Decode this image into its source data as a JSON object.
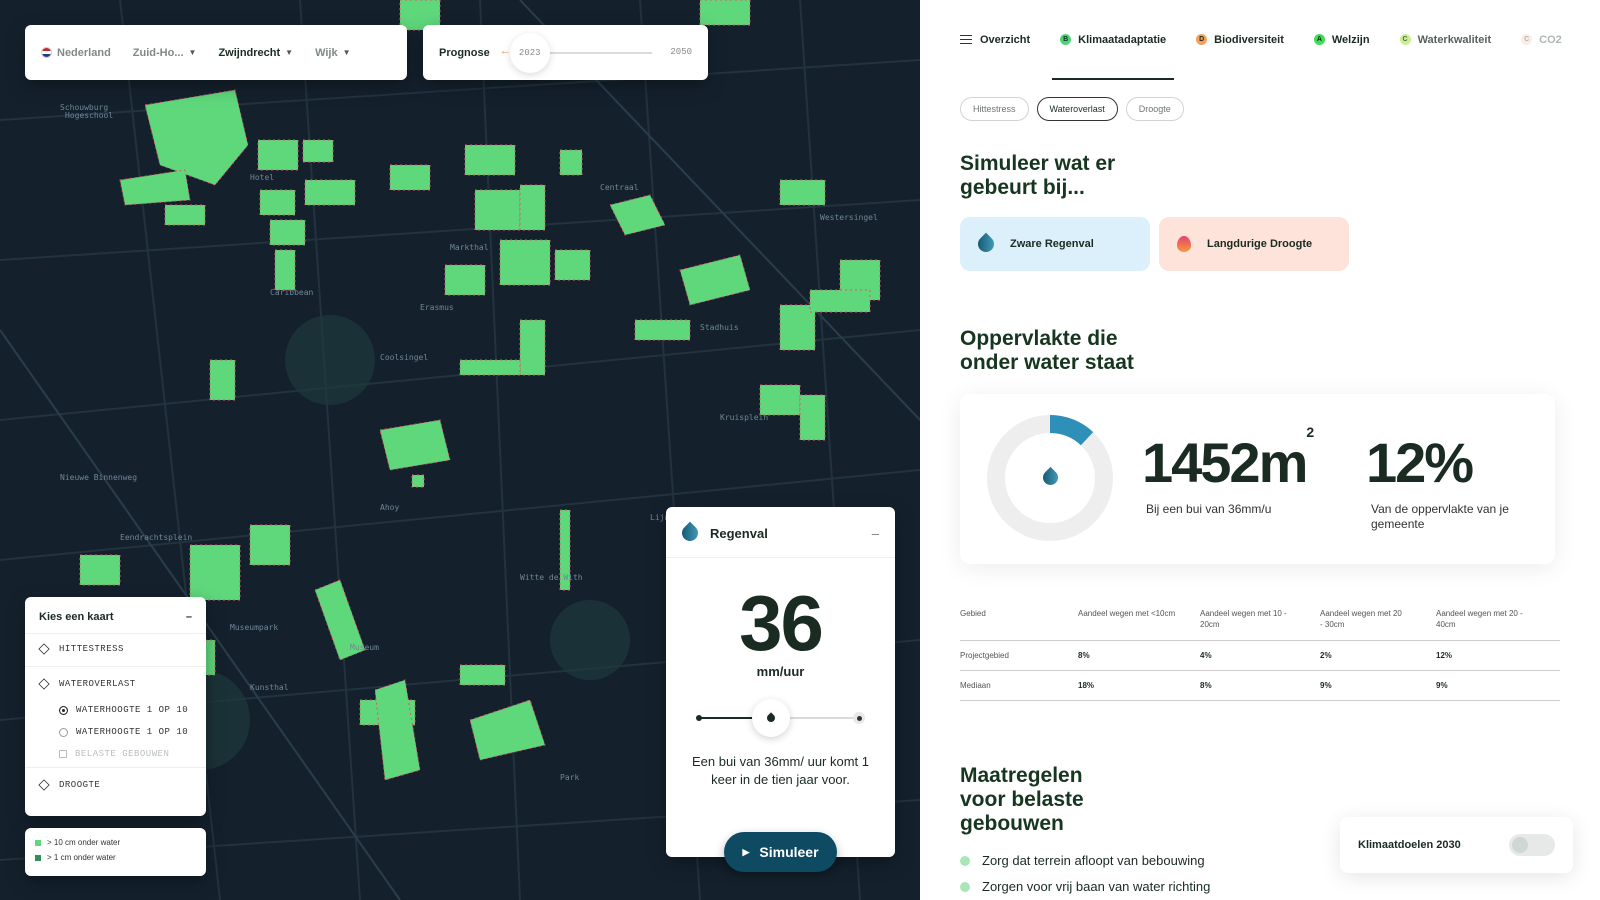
{
  "location": {
    "country": "Nederland",
    "province": "Zuid-Ho...",
    "municipality": "Zwijndrecht",
    "district": "Wijk"
  },
  "prognose": {
    "label": "Prognose",
    "start": "2023",
    "end": "2050"
  },
  "map_labels": [
    "Schouwburg",
    "Hogeschool",
    "Hotel",
    "Caribbean",
    "Ahoy",
    "Museumpark",
    "Kunsthal",
    "Erasmus",
    "Stadhuis",
    "Centraal",
    "Markthal",
    "Witte de With",
    "Lijnbaan",
    "Kruisplein",
    "Coolsingel",
    "Nieuwe Binnenweg",
    "Westersingel",
    "Museum",
    "Park",
    "Eendrachtsplein"
  ],
  "chooser": {
    "title": "Kies een kaart",
    "minimize": "–",
    "items": [
      {
        "label": "HITTESTRESS"
      },
      {
        "label": "WATEROVERLAST"
      }
    ],
    "sub": [
      {
        "label": "WATERHOOGTE 1 OP 10",
        "selected": true
      },
      {
        "label": "WATERHOOGTE 1 OP 10",
        "selected": false
      },
      {
        "label": "BELASTE GEBOUWEN",
        "locked": true
      }
    ],
    "last": "DROOGTE"
  },
  "legend": [
    {
      "label": "> 10 cm onder water",
      "color": "#5fd87c"
    },
    {
      "label": "> 1 cm onder water",
      "color": "#2e8f57"
    }
  ],
  "rain": {
    "title": "Regenval",
    "minimize": "–",
    "value": "36",
    "unit": "mm/uur",
    "description": "Een bui van 36mm/ uur komt 1 keer in de tien jaar voor.",
    "button": "Simuleer"
  },
  "tabs": {
    "overview": "Overzicht",
    "items": [
      {
        "badge": "B",
        "label": "Klimaatadaptatie",
        "color": "#4cd67a"
      },
      {
        "badge": "D",
        "label": "Biodiversiteit",
        "color": "#f5a05a"
      },
      {
        "badge": "A",
        "label": "Welzijn",
        "color": "#3fdc55"
      },
      {
        "badge": "C",
        "label": "Waterkwaliteit",
        "color": "#b6ec6a"
      },
      {
        "badge": "C",
        "label": "CO2",
        "color": "#f7c8b8"
      }
    ]
  },
  "pills": [
    "Hittestress",
    "Wateroverlast",
    "Droogte"
  ],
  "simulate": {
    "title": "Simuleer wat er gebeurt bij...",
    "title_line1": "Simuleer wat er",
    "title_line2": "gebeurt bij...",
    "events": [
      {
        "label": "Zware Regenval",
        "bg": "#dcf0fb"
      },
      {
        "label": "Langdurige Droogte",
        "bg": "#fde3da"
      }
    ]
  },
  "surface": {
    "title_line1": "Oppervlakte die",
    "title_line2": "onder water staat",
    "area": "1452m",
    "area_sup": "2",
    "area_caption": "Bij een bui van 36mm/u",
    "percent": "12%",
    "percent_caption": "Van de oppervlakte van je gemeente",
    "donut_fraction": 0.12
  },
  "table": {
    "headers": [
      "Gebied",
      "Aandeel wegen met <10cm",
      "Aandeel wegen met 10 - 20cm",
      "Aandeel wegen met 20 - 30cm",
      "Aandeel wegen met 20 - 40cm"
    ],
    "rows": [
      [
        "Projectgebied",
        "8%",
        "4%",
        "2%",
        "12%"
      ],
      [
        "Mediaan",
        "18%",
        "8%",
        "9%",
        "9%"
      ]
    ]
  },
  "measures": {
    "title_line1": "Maatregelen",
    "title_line2": "voor belaste",
    "title_line3": "gebouwen",
    "items": [
      "Zorg dat terrein afloopt van bebouwing",
      "Zorgen voor vrij baan van water richting"
    ]
  },
  "toggle": {
    "label": "Klimaatdoelen 2030",
    "on": false
  },
  "colors": {
    "map_bg": "#14212d",
    "building": "#5fd87c",
    "accent": "#0e4a62",
    "text": "#16361f"
  }
}
